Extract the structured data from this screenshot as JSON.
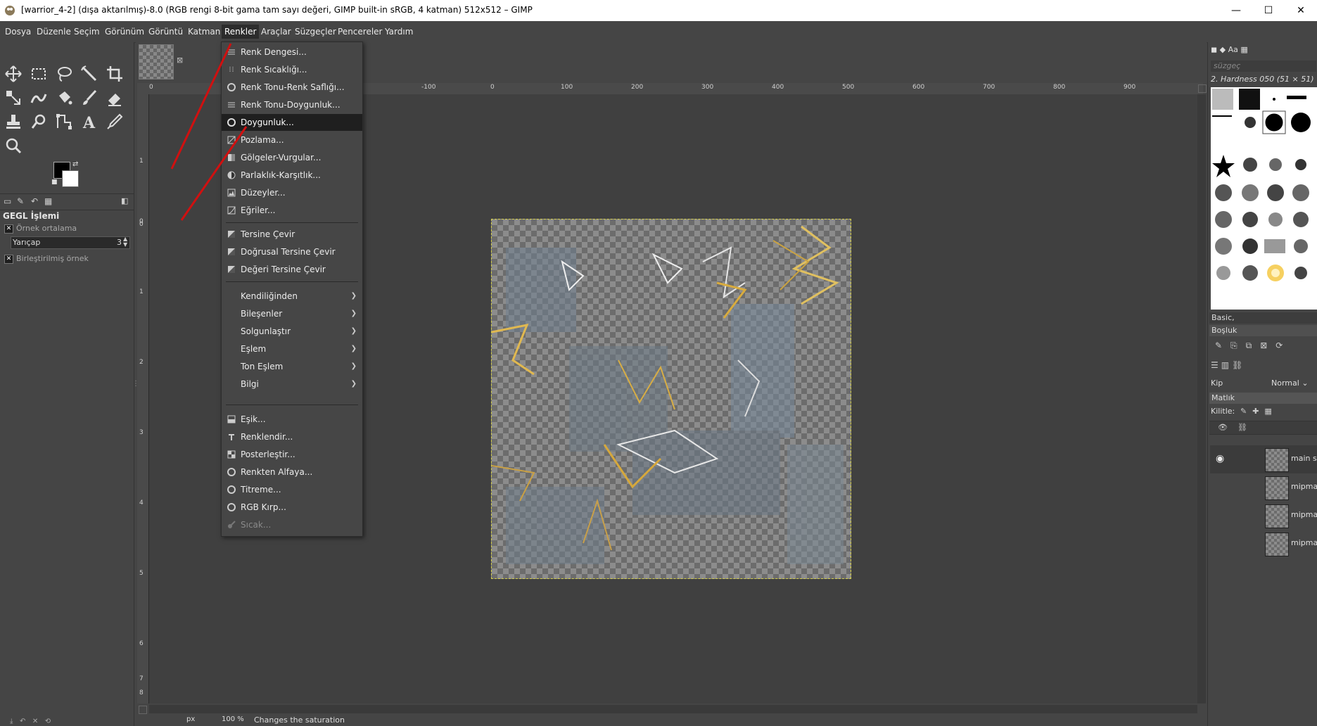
{
  "window": {
    "title": "[warrior_4-2] (dışa aktarılmış)-8.0 (RGB rengi 8-bit gama tam sayı değeri, GIMP built-in sRGB, 4 katman) 512x512 – GIMP",
    "minimize": "—",
    "maximize": "☐",
    "close": "✕"
  },
  "menubar": [
    "Dosya",
    "Düzenle",
    "Seçim",
    "Görünüm",
    "Görüntü",
    "Katman",
    "Renkler",
    "Araçlar",
    "Süzgeçler",
    "Pencereler",
    "Yardım"
  ],
  "active_menu": "Renkler",
  "colors_menu": {
    "group1": [
      "Renk Dengesi...",
      "Renk Sıcaklığı...",
      "Renk Tonu-Renk Saflığı...",
      "Renk Tonu-Doygunluk...",
      "Doygunluk...",
      "Pozlama...",
      "Gölgeler-Vurgular...",
      "Parlaklık-Karşıtlık...",
      "Düzeyler...",
      "Eğriler..."
    ],
    "highlighted": "Doygunluk...",
    "group2": [
      "Tersine Çevir",
      "Doğrusal Tersine Çevir",
      "Değeri Tersine Çevir"
    ],
    "group3": [
      "Kendiliğinden",
      "Bileşenler",
      "Solgunlaştır",
      "Eşlem",
      "Ton Eşlem",
      "Bilgi"
    ],
    "group4": [
      "Eşik...",
      "Renklendir...",
      "Posterleştir...",
      "Renkten Alfaya...",
      "Titreme...",
      "RGB Kırp..."
    ],
    "disabled_item": "Sıcak..."
  },
  "tool_options": {
    "title": "GEGL İşlemi",
    "sample_average": "Örnek ortalama",
    "radius_label": "Yarıçap",
    "radius_value": "3",
    "sample_merged": "Birleştirilmiş örnek"
  },
  "ruler": {
    "top": [
      "0",
      "-100",
      "0",
      "100",
      "200",
      "300",
      "400",
      "500",
      "600",
      "700",
      "800",
      "900"
    ],
    "left": [
      "1",
      "0",
      "0",
      "1",
      "2",
      "3",
      "4",
      "5",
      "6",
      "7",
      "8"
    ]
  },
  "statusbar": {
    "unit": "px",
    "zoom": "100 %",
    "message": "Changes the saturation"
  },
  "dock": {
    "filter_placeholder": "süzgeç",
    "brush_name": "2. Hardness 050 (51 × 51)",
    "brush_tag": "Basic,",
    "spacing_label": "Boşluk",
    "mode_label": "Kip",
    "mode_value": "Normal",
    "opacity_label": "Matlık",
    "lock_label": "Kilitle:",
    "layers": [
      "main su",
      "mipmap",
      "mipmap",
      "mipmap"
    ]
  },
  "colors": {
    "menu_bg": "#464646",
    "highlight": "#1f1f1f",
    "annotation": "#d01010",
    "selection_border": "#d6d04a"
  }
}
